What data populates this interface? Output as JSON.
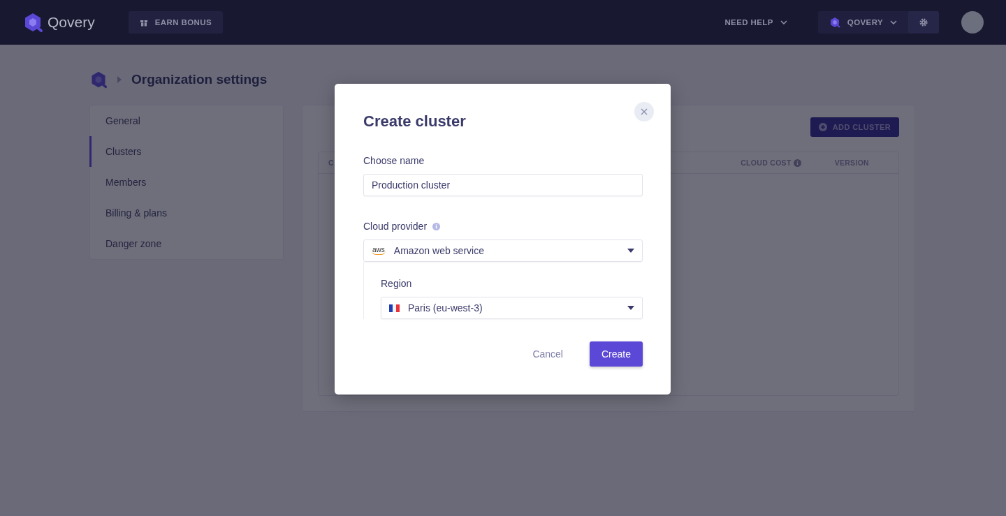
{
  "header": {
    "logo_text": "Qovery",
    "earn_bonus": "EARN BONUS",
    "need_help": "NEED HELP",
    "organization": "QOVERY"
  },
  "breadcrumb": {
    "title": "Organization settings"
  },
  "sidebar": {
    "items": [
      {
        "label": "General",
        "selected": false
      },
      {
        "label": "Clusters",
        "selected": true
      },
      {
        "label": "Members",
        "selected": false
      },
      {
        "label": "Billing & plans",
        "selected": false
      },
      {
        "label": "Danger zone",
        "selected": false
      }
    ]
  },
  "clusters": {
    "add_button": "ADD CLUSTER",
    "columns": [
      {
        "label": "C",
        "info": false
      },
      {
        "label": "CLOUD COST",
        "info": true
      },
      {
        "label": "VERSION",
        "info": false
      }
    ]
  },
  "modal": {
    "title": "Create cluster",
    "name_label": "Choose name",
    "name_value": "Production cluster",
    "provider_label": "Cloud provider",
    "provider_logo": "aws",
    "provider_value": "Amazon web service",
    "region_label": "Region",
    "region_value": "Paris (eu-west-3)",
    "cancel": "Cancel",
    "create": "Create"
  }
}
